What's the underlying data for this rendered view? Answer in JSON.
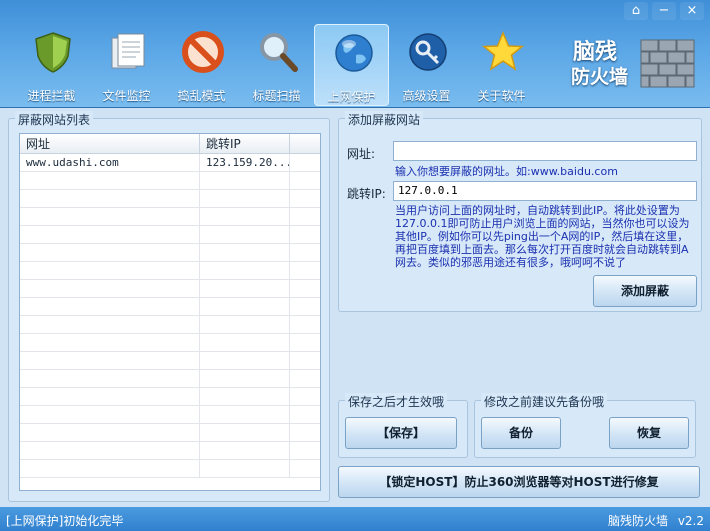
{
  "window": {
    "controls": [
      "⌂",
      "−",
      "×"
    ]
  },
  "toolbar": {
    "items": [
      {
        "label": "进程拦截",
        "icon": "shield-icon"
      },
      {
        "label": "文件监控",
        "icon": "document-icon"
      },
      {
        "label": "捣乱模式",
        "icon": "prohibit-icon"
      },
      {
        "label": "标题扫描",
        "icon": "magnifier-icon"
      },
      {
        "label": "上网保护",
        "icon": "globe-icon"
      },
      {
        "label": "高级设置",
        "icon": "key-icon"
      },
      {
        "label": "关于软件",
        "icon": "star-icon"
      }
    ],
    "active_index": 4,
    "brand_line1": "脑残",
    "brand_line2": "防火墙"
  },
  "blocked_list": {
    "title": "屏蔽网站列表",
    "columns": [
      "网址",
      "跳转IP"
    ],
    "rows": [
      {
        "url": "www.udashi.com",
        "ip": "123.159.20..."
      }
    ]
  },
  "add_site": {
    "title": "添加屏蔽网站",
    "url_label": "网址:",
    "url_value": "",
    "url_hint": "输入你想要屏蔽的网址。如:www.baidu.com",
    "ip_label": "跳转IP:",
    "ip_value": "127.0.0.1",
    "ip_hint": "当用户访问上面的网址时，自动跳转到此IP。将此处设置为127.0.0.1即可防止用户浏览上面的网站，当然你也可以设为其他IP。例如你可以先ping出一个A网的IP，然后填在这里，再把百度填到上面去。那么每次打开百度时就会自动跳转到A网去。类似的邪恶用途还有很多，哦呵呵不说了",
    "add_button": "添加屏蔽"
  },
  "save_group": {
    "title": "保存之后才生效哦",
    "save_button": "【保存】"
  },
  "backup_group": {
    "title": "修改之前建议先备份哦",
    "backup_button": "备份",
    "restore_button": "恢复"
  },
  "lock_host_button": "【锁定HOST】防止360浏览器等对HOST进行修复",
  "status": {
    "message": "[上网保护]初始化完毕",
    "product": "脑残防火墙",
    "version": "v2.2"
  }
}
